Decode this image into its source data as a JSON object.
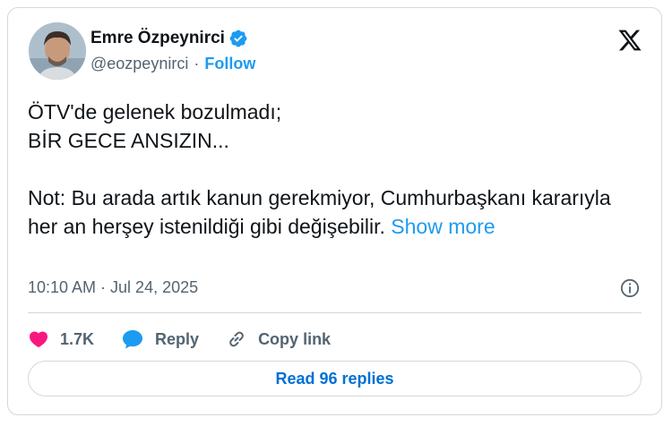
{
  "author": {
    "name": "Emre Özpeynirci",
    "handle": "@eozpeynirci",
    "separator": "·",
    "follow_label": "Follow",
    "verified_icon": "verified-badge-icon",
    "avatar_icon": "avatar-photo"
  },
  "tweet": {
    "text": "ÖTV'de gelenek bozulmadı;\nBİR GECE ANSIZIN...\n\nNot: Bu arada artık kanun gerekmiyor, Cumhurbaşkanı kararıyla her an herşey istenildiği gibi değişebilir. ",
    "show_more": "Show more",
    "timestamp": "10:10 AM · Jul 24, 2025"
  },
  "actions": {
    "like_count": "1.7K",
    "reply_label": "Reply",
    "copy_link_label": "Copy link"
  },
  "read_replies_label": "Read 96 replies",
  "colors": {
    "accent": "#1d9bf0",
    "like": "#f91880",
    "read_text": "#006fd6"
  }
}
